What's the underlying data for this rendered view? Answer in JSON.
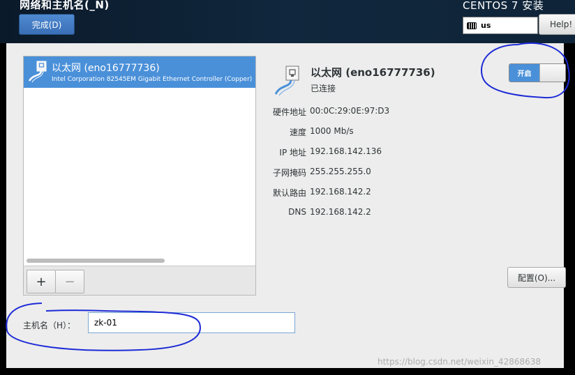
{
  "header": {
    "title": "网络和主机名(_N)",
    "done_label": "完成(D)",
    "install_title": "CENTOS 7 安装",
    "keyboard_layout": "us",
    "help_label": "Help!"
  },
  "device_list": {
    "items": [
      {
        "name": "以太网 (eno16777736)",
        "description": "Intel Corporation 82545EM Gigabit Ethernet Controller (Copper)",
        "selected": true
      }
    ],
    "add_label": "+",
    "remove_label": "−"
  },
  "detail": {
    "name": "以太网 (eno16777736)",
    "status": "已连接",
    "toggle_label": "开启",
    "toggle_on": true,
    "rows": [
      {
        "label": "硬件地址",
        "value": "00:0C:29:0E:97:D3"
      },
      {
        "label": "速度",
        "value": "1000 Mb/s"
      },
      {
        "label": "IP 地址",
        "value": "192.168.142.136"
      },
      {
        "label": "子网掩码",
        "value": "255.255.255.0"
      },
      {
        "label": "默认路由",
        "value": "192.168.142.2"
      },
      {
        "label": "DNS",
        "value": "192.168.142.2"
      }
    ],
    "config_label": "配置(O)..."
  },
  "hostname": {
    "label": "主机名（H）：",
    "value": "zk-01"
  },
  "watermark": "https://blog.csdn.net/weixin_42868638",
  "colors": {
    "accent": "#4a90d9",
    "annotation": "#1d2bd6"
  },
  "icons": [
    "ethernet-cable-icon",
    "keyboard-icon"
  ]
}
